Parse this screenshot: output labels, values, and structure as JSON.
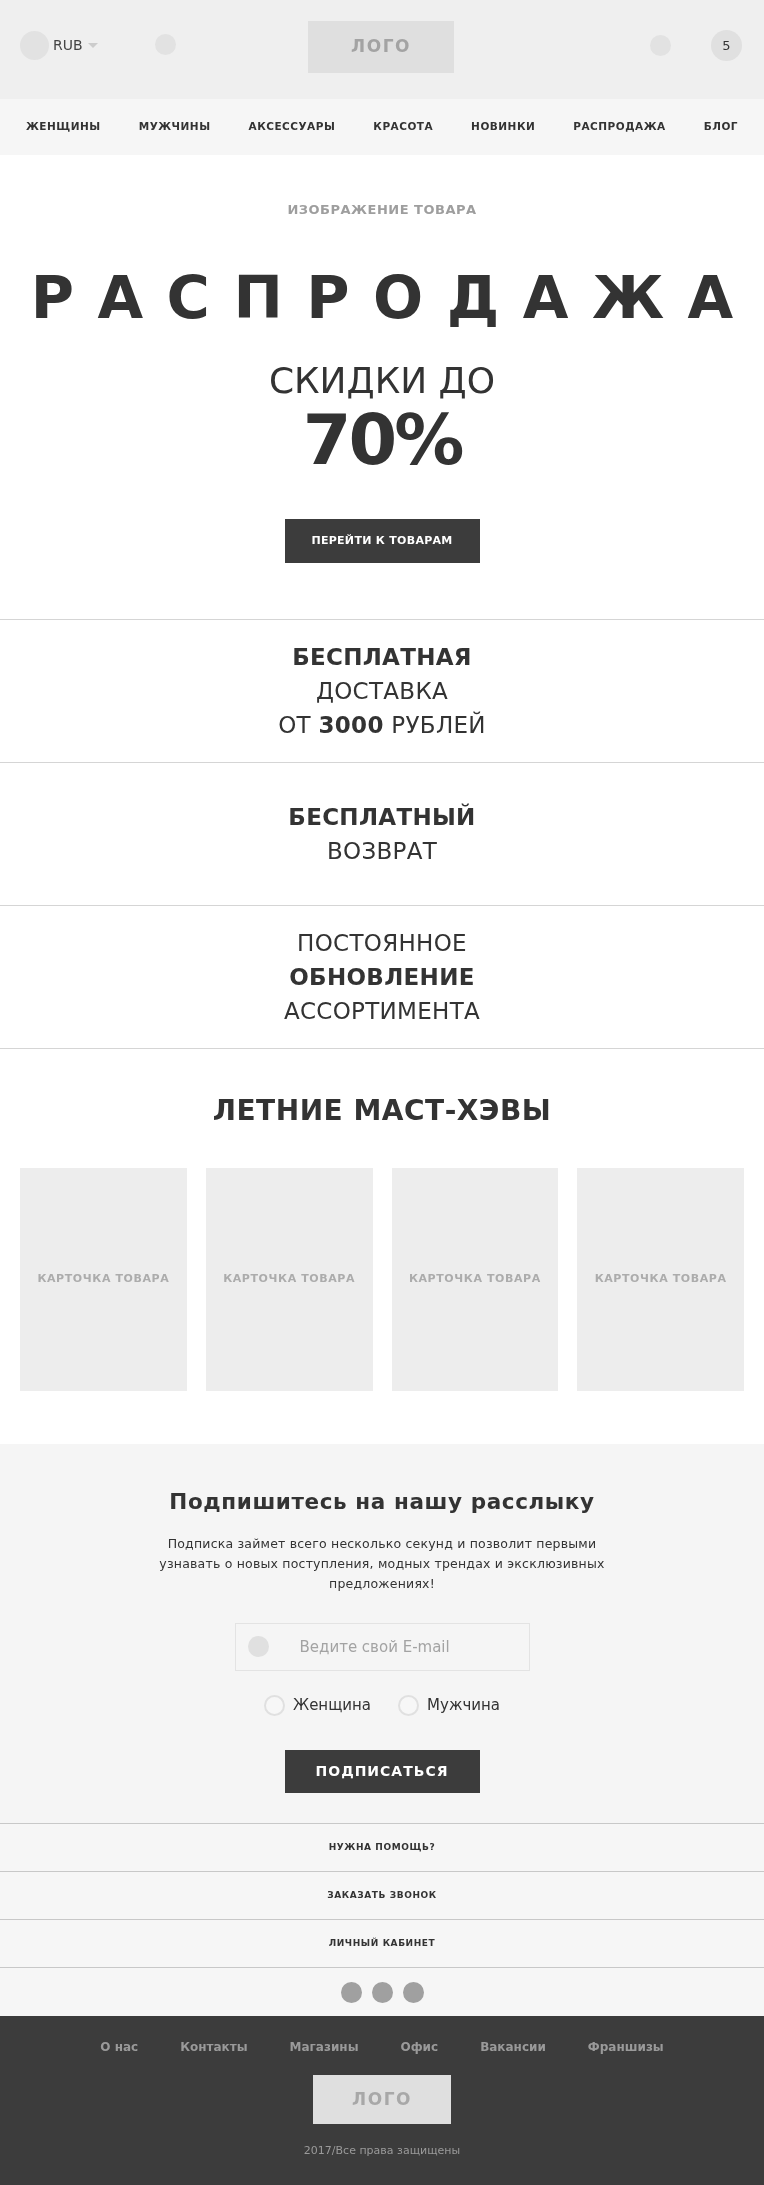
{
  "header": {
    "currency": "RUB",
    "logo": "ЛОГО",
    "cart_count": "5"
  },
  "nav": [
    "ЖЕНЩИНЫ",
    "МУЖЧИНЫ",
    "АКСЕССУАРЫ",
    "КРАСОТА",
    "НОВИНКИ",
    "РАСПРОДАЖА",
    "БЛОГ"
  ],
  "hero": {
    "image_label": "ИЗОБРАЖЕНИЕ ТОВАРА",
    "title": "РАСПРОДАЖА",
    "subtitle": "СКИДКИ ДО",
    "discount": "70%",
    "button": "ПЕРЕЙТИ К ТОВАРАМ"
  },
  "features": [
    {
      "lines": [
        "**БЕСПЛАТНАЯ**",
        "ДОСТАВКА",
        "ОТ **3000** РУБЛЕЙ"
      ]
    },
    {
      "lines": [
        "**БЕСПЛАТНЫЙ**",
        "ВОЗВРАТ"
      ]
    },
    {
      "lines": [
        "ПОСТОЯННОЕ",
        "**ОБНОВЛЕНИЕ**",
        "АССОРТИМЕНТА"
      ]
    }
  ],
  "products": {
    "title": "ЛЕТНИЕ МАСТ-ХЭВЫ",
    "cards": [
      {
        "label": "КАРТОЧКА ТОВАРА"
      },
      {
        "label": "КАРТОЧКА ТОВАРА"
      },
      {
        "label": "КАРТОЧКА ТОВАРА"
      },
      {
        "label": "КАРТОЧКА ТОВАРА"
      }
    ]
  },
  "newsletter": {
    "title": "Подпишитесь на нашу расслыку",
    "text": "Подписка займет всего несколько секунд и позволит первыми узнавать о новых поступления, модных трендах и эксклюзивных предложениях!",
    "email": {
      "placeholder": "Ведите свой E-mail"
    },
    "gender_options": [
      {
        "label": "Женщина",
        "selected": false
      },
      {
        "label": "Мужчина",
        "selected": false
      }
    ],
    "button": "ПОДПИСАТЬСЯ"
  },
  "help_links": [
    "НУЖНА ПОМОЩЬ?",
    "ЗАКАЗАТЬ ЗВОНОК",
    "ЛИЧНЫЙ КАБИНЕТ"
  ],
  "footer": {
    "links": [
      "О нас",
      "Контакты",
      "Магазины",
      "Офис",
      "Вакансии",
      "Франшизы"
    ],
    "logo": "ЛОГО",
    "copyright": "2017/Все права защищены"
  }
}
